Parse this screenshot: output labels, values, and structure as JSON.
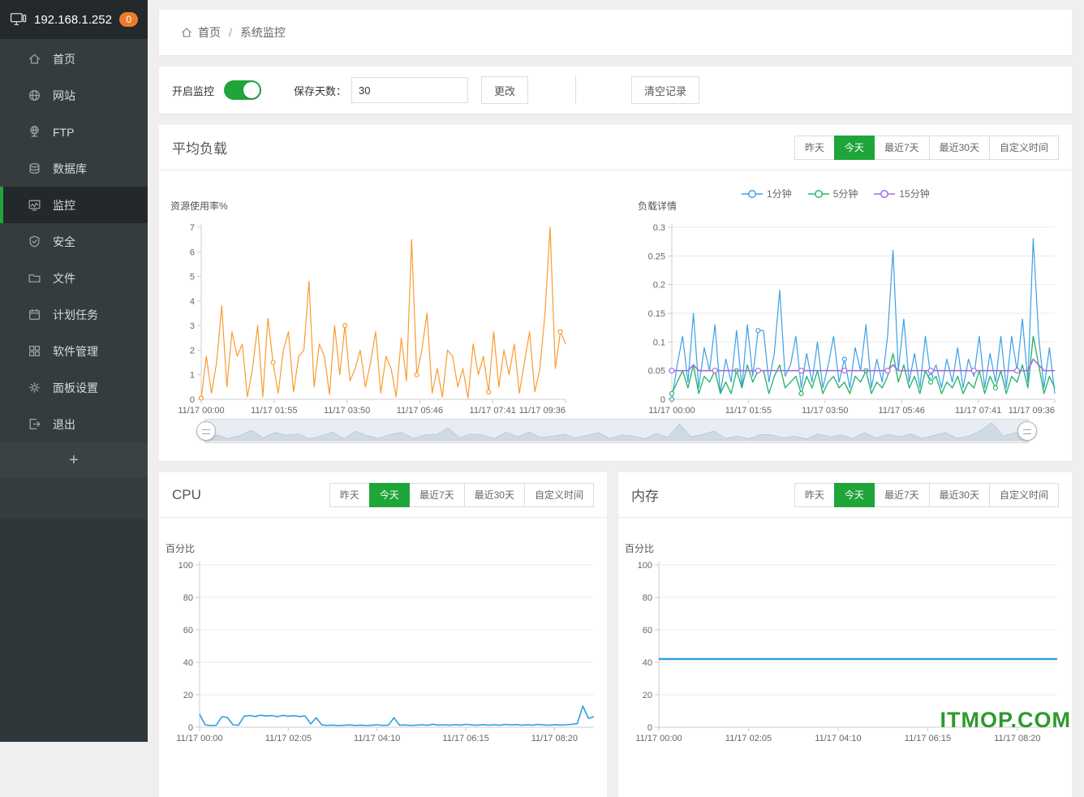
{
  "panel": {
    "ip": "192.168.1.252",
    "msg_badge": "0"
  },
  "sidebar": {
    "items": [
      {
        "id": "home",
        "label": "首页",
        "icon": "home-icon",
        "active": false
      },
      {
        "id": "site",
        "label": "网站",
        "icon": "globe-icon",
        "active": false
      },
      {
        "id": "ftp",
        "label": "FTP",
        "icon": "ftp-globe-icon",
        "active": false
      },
      {
        "id": "database",
        "label": "数据库",
        "icon": "database-icon",
        "active": false
      },
      {
        "id": "monitor",
        "label": "监控",
        "icon": "monitor-chart-icon",
        "active": true
      },
      {
        "id": "security",
        "label": "安全",
        "icon": "shield-check-icon",
        "active": false
      },
      {
        "id": "files",
        "label": "文件",
        "icon": "folder-icon",
        "active": false
      },
      {
        "id": "cron",
        "label": "计划任务",
        "icon": "calendar-icon",
        "active": false
      },
      {
        "id": "software",
        "label": "软件管理",
        "icon": "grid-icon",
        "active": false
      },
      {
        "id": "settings",
        "label": "面板设置",
        "icon": "gear-icon",
        "active": false
      },
      {
        "id": "logout",
        "label": "退出",
        "icon": "logout-icon",
        "active": false
      }
    ],
    "add_button": "+"
  },
  "breadcrumb": {
    "home": "首页",
    "separator": "/",
    "current": "系统监控"
  },
  "controls": {
    "monitor_label": "开启监控",
    "monitor_on": true,
    "days_label": "保存天数：",
    "days_value": "30",
    "apply_label": "更改",
    "clear_label": "清空记录"
  },
  "time_ranges": {
    "options": [
      "昨天",
      "今天",
      "最近7天",
      "最近30天",
      "自定义时间"
    ],
    "selected": "今天"
  },
  "sections": {
    "load": "平均负载",
    "cpu": "CPU",
    "memory": "内存"
  },
  "legend": [
    {
      "label": "1分钟",
      "color": "#3ba0e8"
    },
    {
      "label": "5分钟",
      "color": "#2db56e"
    },
    {
      "label": "15分钟",
      "color": "#a46be0"
    }
  ],
  "colors": {
    "accent_green": "#20a53a",
    "badge_orange": "#ed7b2f",
    "load_line_orange": "#fb9b2f",
    "cpu_line_blue": "#2f9fe0"
  },
  "watermark": "ITMOP.COM",
  "chart_data": [
    {
      "id": "load_usage",
      "type": "line",
      "title": "资源使用率%",
      "x_tick_labels": [
        "11/17 00:00",
        "11/17 01:55",
        "11/17 03:50",
        "11/17 05:46",
        "11/17 07:41",
        "11/17 09:36"
      ],
      "x_tick_fracs": [
        0,
        0.2,
        0.4,
        0.6,
        0.8,
        1.0
      ],
      "ylim": [
        0,
        7
      ],
      "yticks": [
        0,
        1,
        2,
        3,
        4,
        5,
        6,
        7
      ],
      "ylabels": [
        "0",
        "1",
        "2",
        "3",
        "4",
        "5",
        "6",
        "7"
      ],
      "grid": false,
      "legend_position": "none",
      "series": [
        {
          "name": "资源使用率%",
          "color": "#fb9b2f",
          "width": 1.2,
          "marker_every": 14,
          "marker_r": 2.5,
          "values": [
            0.05,
            1.75,
            0.25,
            1.5,
            3.8,
            0.5,
            2.75,
            1.75,
            2.25,
            0.1,
            1.25,
            3,
            0.1,
            3.3,
            1.5,
            0.25,
            2,
            2.75,
            0.3,
            1.75,
            2,
            4.8,
            0.5,
            2.25,
            1.75,
            0.2,
            3,
            1,
            3,
            0.75,
            1.25,
            2,
            0.5,
            1.5,
            2.75,
            0.25,
            1.75,
            1.25,
            0.1,
            2.5,
            0.75,
            6.5,
            1,
            2,
            3.5,
            0.25,
            1.25,
            0.1,
            2,
            1.75,
            0.5,
            1.25,
            0.05,
            2.25,
            1,
            1.75,
            0.3,
            2.75,
            0.5,
            2,
            1,
            2.25,
            0.25,
            1.5,
            2.75,
            0.3,
            1.25,
            3.5,
            7,
            1.25,
            2.75,
            2.25
          ]
        }
      ]
    },
    {
      "id": "load_detail",
      "type": "line",
      "title": "负载详情",
      "x_tick_labels": [
        "11/17 00:00",
        "11/17 01:55",
        "11/17 03:50",
        "11/17 05:46",
        "11/17 07:41",
        "11/17 09:36"
      ],
      "x_tick_fracs": [
        0,
        0.2,
        0.4,
        0.6,
        0.8,
        1.0
      ],
      "ylim": [
        0,
        0.3
      ],
      "yticks": [
        0,
        0.05,
        0.1,
        0.15,
        0.2,
        0.25,
        0.3
      ],
      "ylabels": [
        "0",
        "0.05",
        "0.1",
        "0.15",
        "0.2",
        "0.25",
        "0.3"
      ],
      "grid": true,
      "legend_position": "top",
      "series": [
        {
          "name": "1分钟",
          "color": "#3ba0e8",
          "width": 1.2,
          "marker_every": 16,
          "marker_r": 2.5,
          "values": [
            0,
            0.06,
            0.11,
            0.03,
            0.15,
            0.02,
            0.09,
            0.05,
            0.13,
            0.01,
            0.07,
            0.03,
            0.12,
            0.02,
            0.13,
            0.04,
            0.12,
            0.12,
            0.03,
            0.08,
            0.19,
            0.04,
            0.06,
            0.11,
            0.02,
            0.08,
            0.03,
            0.1,
            0.02,
            0.06,
            0.11,
            0.03,
            0.07,
            0.02,
            0.09,
            0.05,
            0.13,
            0.02,
            0.07,
            0.03,
            0.11,
            0.26,
            0.05,
            0.14,
            0.03,
            0.08,
            0.02,
            0.11,
            0.04,
            0.06,
            0.02,
            0.07,
            0.03,
            0.09,
            0.02,
            0.07,
            0.04,
            0.11,
            0.02,
            0.08,
            0.03,
            0.11,
            0.02,
            0.11,
            0.05,
            0.14,
            0.03,
            0.28,
            0.11,
            0.02,
            0.09,
            0.01
          ]
        },
        {
          "name": "5分钟",
          "color": "#2db56e",
          "width": 1.4,
          "marker_every": 12,
          "marker_r": 2.5,
          "values": [
            0.01,
            0.03,
            0.05,
            0.02,
            0.06,
            0.01,
            0.04,
            0.03,
            0.05,
            0.01,
            0.03,
            0.01,
            0.05,
            0.02,
            0.06,
            0.03,
            0.05,
            0.05,
            0.01,
            0.04,
            0.06,
            0.02,
            0.03,
            0.04,
            0.01,
            0.04,
            0.02,
            0.05,
            0.01,
            0.03,
            0.04,
            0.02,
            0.03,
            0.01,
            0.04,
            0.03,
            0.05,
            0.01,
            0.03,
            0.02,
            0.04,
            0.08,
            0.03,
            0.06,
            0.02,
            0.04,
            0.01,
            0.05,
            0.03,
            0.04,
            0.01,
            0.03,
            0.02,
            0.04,
            0.01,
            0.03,
            0.02,
            0.05,
            0.01,
            0.04,
            0.02,
            0.05,
            0.01,
            0.04,
            0.03,
            0.06,
            0.02,
            0.11,
            0.06,
            0.01,
            0.04,
            0.02
          ]
        },
        {
          "name": "15分钟",
          "color": "#a46be0",
          "width": 1.6,
          "marker_every": 8,
          "marker_r": 3,
          "values": [
            0.05,
            0.05,
            0.05,
            0.05,
            0.06,
            0.05,
            0.05,
            0.05,
            0.05,
            0.05,
            0.05,
            0.05,
            0.05,
            0.05,
            0.05,
            0.05,
            0.05,
            0.05,
            0.05,
            0.05,
            0.05,
            0.05,
            0.05,
            0.05,
            0.05,
            0.05,
            0.05,
            0.05,
            0.05,
            0.05,
            0.05,
            0.05,
            0.05,
            0.05,
            0.05,
            0.05,
            0.05,
            0.05,
            0.05,
            0.05,
            0.05,
            0.06,
            0.05,
            0.05,
            0.05,
            0.05,
            0.05,
            0.05,
            0.05,
            0.05,
            0.05,
            0.05,
            0.05,
            0.05,
            0.05,
            0.05,
            0.05,
            0.05,
            0.05,
            0.05,
            0.05,
            0.05,
            0.05,
            0.05,
            0.05,
            0.05,
            0.05,
            0.07,
            0.06,
            0.05,
            0.05,
            0.05
          ]
        }
      ]
    },
    {
      "id": "cpu",
      "type": "line",
      "title": "百分比",
      "x_tick_labels": [
        "11/17 00:00",
        "11/17 02:05",
        "11/17 04:10",
        "11/17 06:15",
        "11/17 08:20"
      ],
      "x_tick_fracs": [
        0,
        0.225,
        0.45,
        0.675,
        0.9
      ],
      "ylim": [
        0,
        100
      ],
      "yticks": [
        0,
        20,
        40,
        60,
        80,
        100
      ],
      "ylabels": [
        "0",
        "20",
        "40",
        "60",
        "80",
        "100"
      ],
      "grid": true,
      "legend_position": "none",
      "series": [
        {
          "name": "CPU",
          "color": "#2f9fe0",
          "width": 1.6,
          "values": [
            8,
            1.5,
            1,
            1.2,
            6.5,
            6,
            1.5,
            1.2,
            6.8,
            7.2,
            6.6,
            7.4,
            6.9,
            7.2,
            6.5,
            7.3,
            6.8,
            7.1,
            6.6,
            6.9,
            2,
            5.8,
            1.4,
            1.1,
            1.3,
            1,
            1.2,
            1.4,
            1.1,
            1.3,
            1,
            1.2,
            1.5,
            1.1,
            1.3,
            5.8,
            1.2,
            1.4,
            1.1,
            1.3,
            1.5,
            1.2,
            1.8,
            1.3,
            1.5,
            1.2,
            1.6,
            1.3,
            1.8,
            1.4,
            1.2,
            1.6,
            1.3,
            1.5,
            1.2,
            1.7,
            1.4,
            1.6,
            1.2,
            1.5,
            1.3,
            1.7,
            1.4,
            1.2,
            1.6,
            1.3,
            1.5,
            1.8,
            2.2,
            13,
            5.5,
            6.5
          ]
        }
      ]
    },
    {
      "id": "mem",
      "type": "line",
      "title": "百分比",
      "x_tick_labels": [
        "11/17 00:00",
        "11/17 02:05",
        "11/17 04:10",
        "11/17 06:15",
        "11/17 08:20"
      ],
      "x_tick_fracs": [
        0,
        0.225,
        0.45,
        0.675,
        0.9
      ],
      "ylim": [
        0,
        100
      ],
      "yticks": [
        0,
        20,
        40,
        60,
        80,
        100
      ],
      "ylabels": [
        "0",
        "20",
        "40",
        "60",
        "80",
        "100"
      ],
      "grid": true,
      "legend_position": "none",
      "series": [
        {
          "name": "内存",
          "color": "#2f9fe0",
          "width": 2.6,
          "values": [
            42,
            42,
            42,
            42,
            42,
            42,
            42,
            42,
            42,
            42,
            42,
            42,
            42,
            42,
            42,
            42,
            42,
            42,
            42,
            42,
            42,
            42,
            42,
            42,
            42,
            42,
            42,
            42,
            42,
            42,
            42,
            42,
            42,
            42,
            42,
            42,
            42,
            42,
            42,
            42,
            42,
            42,
            42,
            42,
            42,
            42,
            42,
            42,
            42,
            42,
            42,
            42,
            42,
            42,
            42,
            42,
            42,
            42,
            42,
            42,
            42,
            42,
            42,
            42,
            42,
            42,
            42,
            42,
            42,
            42,
            42,
            42
          ]
        }
      ]
    }
  ]
}
